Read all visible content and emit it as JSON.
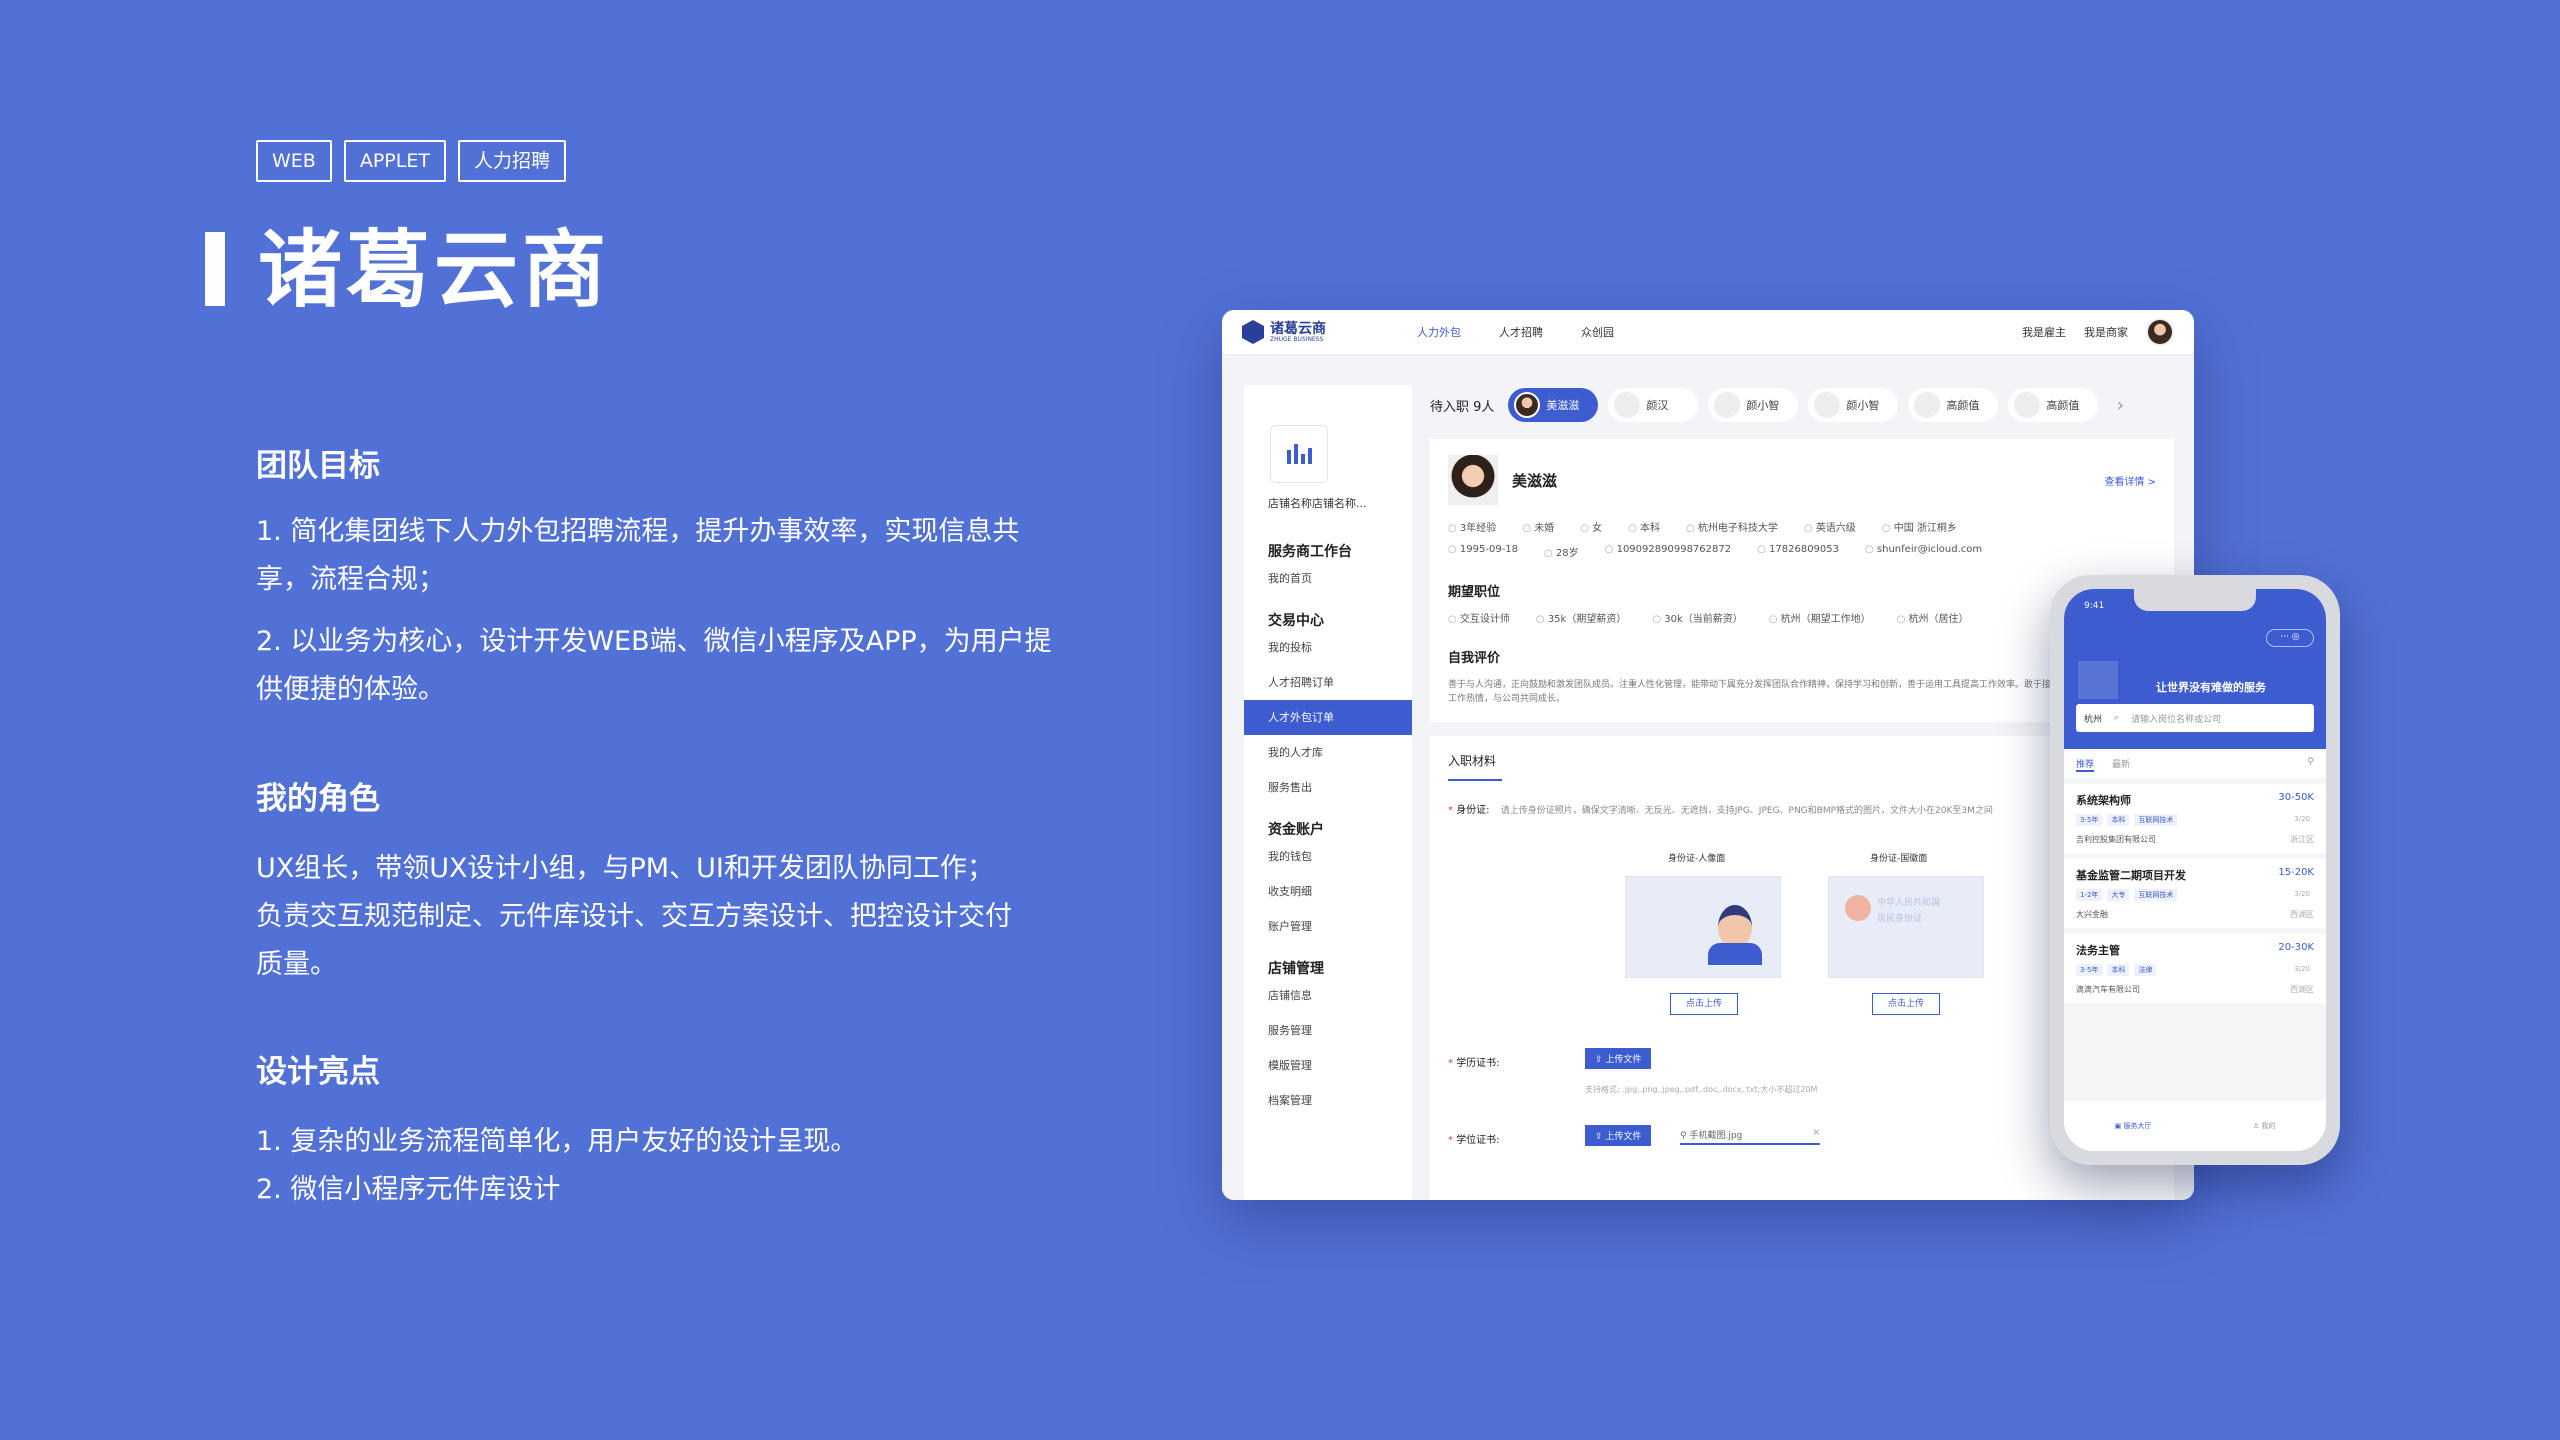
{
  "tags": [
    "WEB",
    "APPLET",
    "人力招聘"
  ],
  "title": "诸葛云商",
  "sections": {
    "goal": {
      "heading": "团队目标",
      "items": [
        "1. 简化集团线下人力外包招聘流程，提升办事效率，实现信息共享，流程合规；",
        "2. 以业务为核心，设计开发WEB端、微信小程序及APP，为用户提供便捷的体验。"
      ]
    },
    "role": {
      "heading": "我的角色",
      "text": "UX组长，带领UX设计小组，与PM、UI和开发团队协同工作；负责交互规范制定、元件库设计、交互方案设计、把控设计交付质量。"
    },
    "highlight": {
      "heading": "设计亮点",
      "items": [
        "1. 复杂的业务流程简单化，用户友好的设计呈现。",
        "2. 微信小程序元件库设计"
      ]
    }
  },
  "web": {
    "logo": "诸葛云商",
    "logo_sub": "ZHUGE BUSINESS",
    "nav": [
      "人力外包",
      "人才招聘",
      "众创园"
    ],
    "right": [
      "我是雇主",
      "我是商家"
    ],
    "shop_name": "店铺名称店铺名称...",
    "sidebar": {
      "g1": "服务商工作台",
      "g1_items": [
        "我的首页"
      ],
      "g2": "交易中心",
      "g2_items": [
        "我的投标",
        "人才招聘订单",
        "人才外包订单",
        "我的人才库",
        "服务售出"
      ],
      "g3": "资金账户",
      "g3_items": [
        "我的钱包",
        "收支明细",
        "账户管理"
      ],
      "g4": "店铺管理",
      "g4_items": [
        "店铺信息",
        "服务管理",
        "模版管理",
        "档案管理"
      ]
    },
    "pending_label": "待入职 9人",
    "candidates": [
      "美滋滋",
      "颜汉",
      "颜小智",
      "颜小智",
      "高颜值",
      "高颜值"
    ],
    "profile": {
      "name": "美滋滋",
      "detail": "查看详情 >",
      "row1": [
        "3年经验",
        "未婚",
        "女",
        "本科",
        "杭州电子科技大学",
        "英语六级",
        "中国 浙江桐乡"
      ],
      "row2": [
        "1995-09-18",
        "28岁",
        "109092890998762872",
        "17826809053",
        "shunfeir@icloud.com"
      ],
      "expect_h": "期望职位",
      "expect": [
        "交互设计师",
        "35k（期望薪资）",
        "30k（当前薪资）",
        "杭州（期望工作地）",
        "杭州（居住）"
      ],
      "intro_h": "自我评价",
      "intro": "善于与人沟通，正向鼓励和激发团队成员。注重人性化管理，能带动下属充分发挥团队合作精神，保持学习和创新，善于运用工具提高工作效率。敢于接受挑战及承担责任，富有工作热情，与公司共同成长。"
    },
    "upload": {
      "tab": "入职材料",
      "id_label": "身份证:",
      "id_hint": "请上传身份证照片，确保文字清晰、无反光、无遮挡，支持JPG、JPEG、PNG和BMP格式的图片，文件大小在20K至3M之间",
      "front": "身份证-人像面",
      "back": "身份证-国徽面",
      "click": "点击上传",
      "edu_label": "学历证书:",
      "upload_btn": "上传文件",
      "formats": "支持格式: .jpg,.png,.jpeg,.pdf,.doc,.docx,.txt;大小不超过20M",
      "degree_label": "学位证书:",
      "file": "手机截图.jpg",
      "id_card_text": "中华人民共和国\n居民身份证"
    }
  },
  "phone": {
    "time": "9:41",
    "slogan": "让世界没有难做的服务",
    "city": "杭州",
    "placeholder": "请输入岗位名称或公司",
    "tabs": [
      "推荐",
      "最新"
    ],
    "jobs": [
      {
        "title": "系统架构师",
        "salary": "30-50K",
        "tags": [
          "3-5年",
          "本科",
          "互联网技术"
        ],
        "date": "3/20",
        "company": "吉利控股集团有限公司",
        "city": "浙江区"
      },
      {
        "title": "基金监管二期项目开发",
        "salary": "15-20K",
        "tags": [
          "1-2年",
          "大专",
          "互联网技术"
        ],
        "date": "3/20",
        "company": "大兴金融",
        "city": "西湖区"
      },
      {
        "title": "法务主管",
        "salary": "20-30K",
        "tags": [
          "3-5年",
          "本科",
          "法律"
        ],
        "date": "3/20",
        "company": "滴滴汽车有限公司",
        "city": "西湖区"
      }
    ],
    "tabbar": [
      "服务大厅",
      "我的"
    ]
  }
}
